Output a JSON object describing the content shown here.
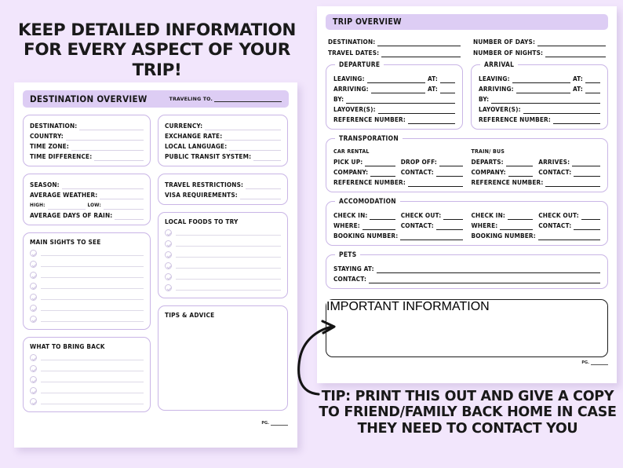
{
  "colors": {
    "background": "#f2e6fc",
    "band": "#ddcdf4",
    "card_border": "#c9b5e6",
    "ink": "#161616",
    "rule_light": "#d9d2e6",
    "rule_dark": "#1d1d1d"
  },
  "headline": "KEEP DETAILED INFORMATION FOR EVERY ASPECT OF YOUR TRIP!",
  "caption": "TIP: PRINT THIS OUT AND GIVE A COPY TO FRIEND/FAMILY BACK HOME IN CASE THEY NEED TO CONTACT YOU",
  "page_footer": "PG.",
  "left_page": {
    "band_title": "DESTINATION OVERVIEW",
    "band_field": "TRAVELING TO.",
    "destination_card": {
      "fields": [
        "DESTINATION:",
        "COUNTRY:",
        "TIME ZONE:",
        "TIME DIFFERENCE:"
      ]
    },
    "currency_card": {
      "fields": [
        "CURRENCY:",
        "EXCHANGE RATE:",
        "LOCAL LANGUAGE:",
        "PUBLIC TRANSIT SYSTEM:"
      ]
    },
    "weather_card": {
      "fields": [
        "SEASON:",
        "AVERAGE WEATHER:"
      ],
      "high_label": "HIGH:",
      "low_label": "LOW:",
      "rain_label": "AVERAGE DAYS OF RAIN:"
    },
    "restrictions_card": {
      "fields": [
        "TRAVEL RESTRICTIONS:",
        "VISA REQUIREMENTS:"
      ]
    },
    "main_sights": {
      "title": "MAIN SIGHTS TO SEE",
      "rows": 7
    },
    "local_foods": {
      "title": "LOCAL FOODS TO TRY",
      "rows": 6
    },
    "bring_back": {
      "title": "WHAT TO BRING BACK",
      "rows": 5
    },
    "tips_advice": {
      "title": "TIPS & ADVICE"
    }
  },
  "right_page": {
    "band_title": "TRIP OVERVIEW",
    "top_left_fields": [
      "DESTINATION:",
      "TRAVEL DATES:"
    ],
    "top_right_fields": [
      "NUMBER OF DAYS:",
      "NUMBER OF NIGHTS:"
    ],
    "departure": {
      "legend": "DEPARTURE",
      "leaving": "LEAVING:",
      "arriving": "ARRIVING:",
      "at": "AT:",
      "by": "BY:",
      "layovers": "LAYOVER(S):",
      "reference": "REFERENCE NUMBER:"
    },
    "arrival": {
      "legend": "ARRIVAL",
      "leaving": "LEAVING:",
      "arriving": "ARRIVING:",
      "at": "AT:",
      "by": "BY:",
      "layovers": "LAYOVER(S):",
      "reference": "REFERENCE NUMBER:"
    },
    "transportation": {
      "legend": "TRANSPORATION",
      "car_rental": "CAR RENTAL",
      "train_bus": "TRAIN/ BUS",
      "pick_up": "PICK UP:",
      "drop_off": "DROP OFF:",
      "departs": "DEPARTS:",
      "arrives": "ARRIVES:",
      "company": "COMPANY:",
      "contact": "CONTACT:",
      "reference": "REFERENCE NUMBER:"
    },
    "accommodation": {
      "legend": "ACCOMODATION",
      "check_in": "CHECK IN:",
      "check_out": "CHECK OUT:",
      "where": "WHERE:",
      "contact": "CONTACT:",
      "booking": "BOOKING NUMBER:"
    },
    "pets": {
      "legend": "PETS",
      "staying_at": "STAYING AT:",
      "contact": "CONTACT:"
    },
    "important": {
      "legend": "IMPORTANT INFORMATION"
    }
  }
}
